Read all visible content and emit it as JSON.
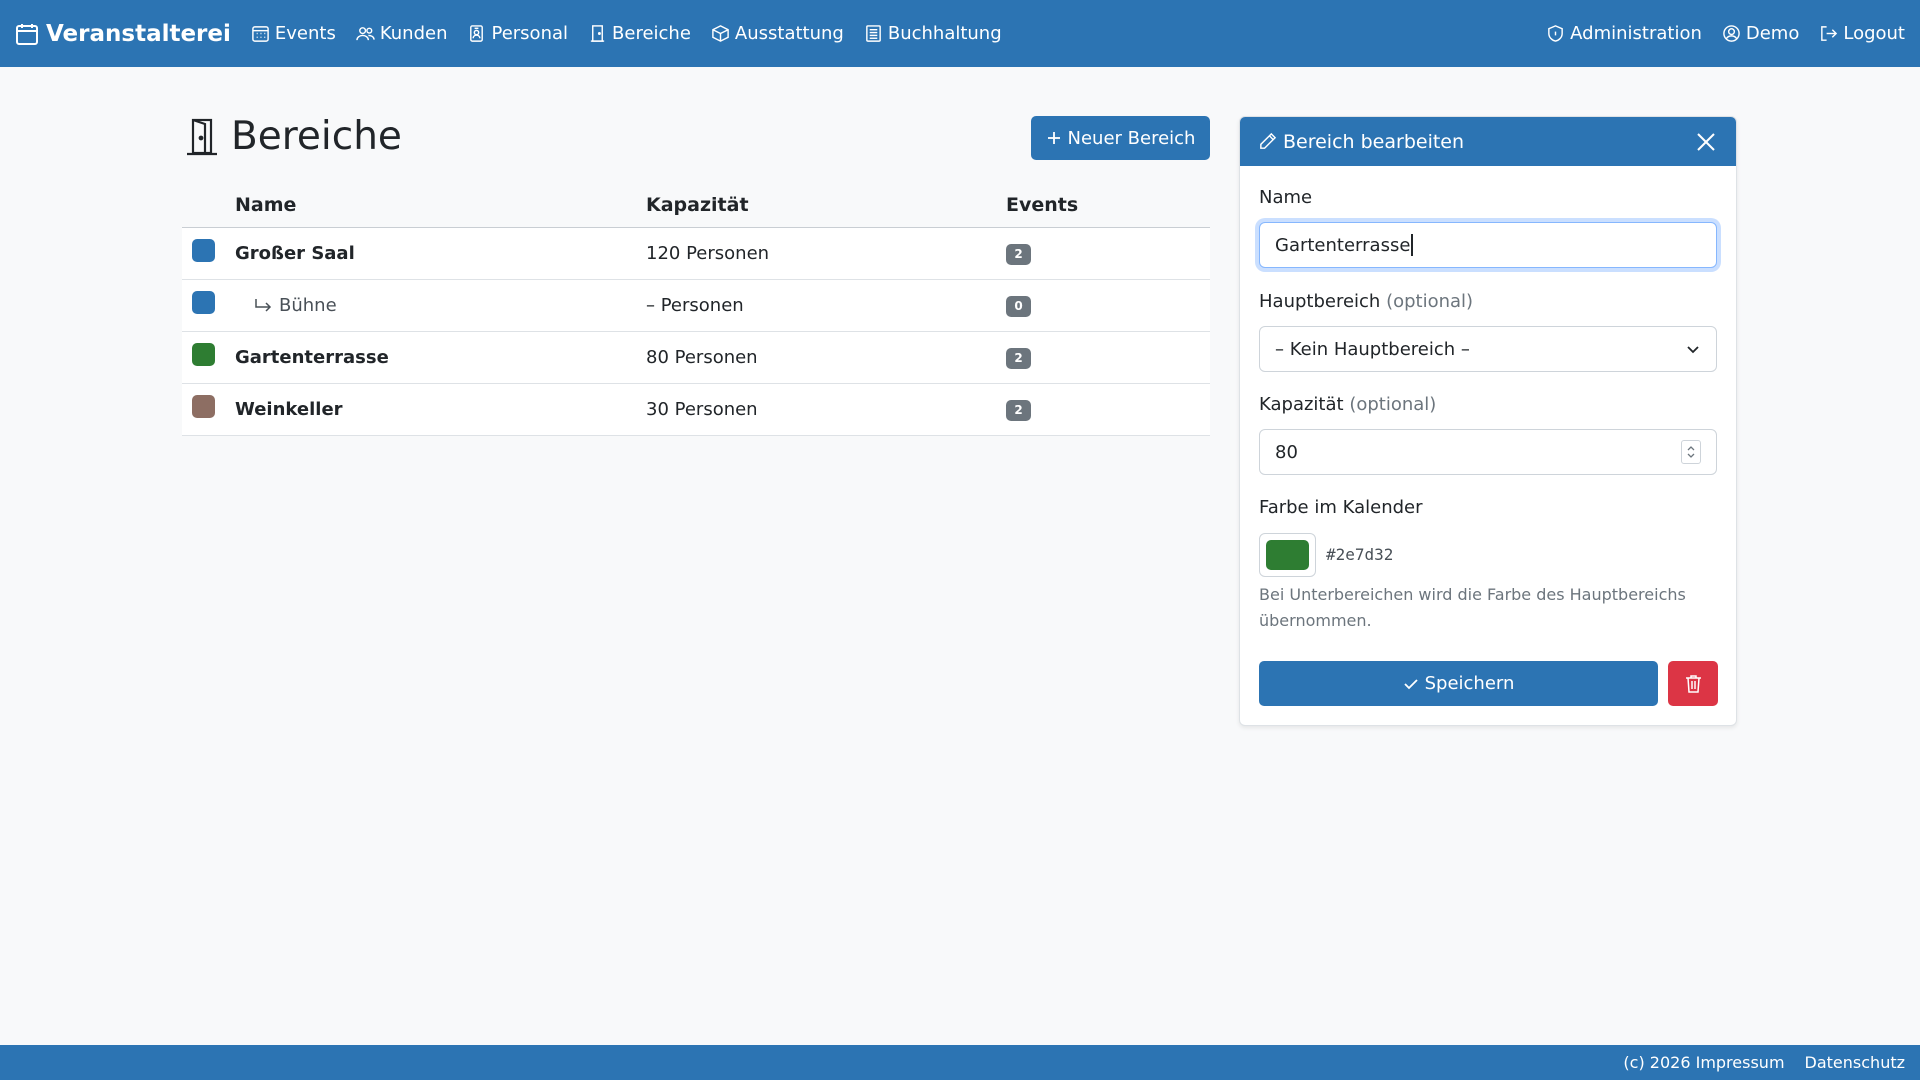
{
  "navbar": {
    "brand": "Veranstalterei",
    "links": [
      {
        "label": "Events",
        "icon": "calendar-grid-icon"
      },
      {
        "label": "Kunden",
        "icon": "people-icon"
      },
      {
        "label": "Personal",
        "icon": "badge-icon"
      },
      {
        "label": "Bereiche",
        "icon": "door-icon"
      },
      {
        "label": "Ausstattung",
        "icon": "box-icon"
      },
      {
        "label": "Buchhaltung",
        "icon": "ledger-icon"
      }
    ],
    "right": [
      {
        "label": "Administration",
        "icon": "shield-icon"
      },
      {
        "label": "Demo",
        "icon": "user-circle-icon"
      },
      {
        "label": "Logout",
        "icon": "logout-icon"
      }
    ]
  },
  "page": {
    "title": "Bereiche",
    "new_button": "Neuer Bereich"
  },
  "table": {
    "headers": {
      "name": "Name",
      "capacity": "Kapazität",
      "events": "Events"
    },
    "rows": [
      {
        "name": "Großer Saal",
        "capacity": "120 Personen",
        "events": "2",
        "color": "#2c74b3",
        "sub": false
      },
      {
        "name": "Bühne",
        "capacity": "– Personen",
        "events": "0",
        "color": "#2c74b3",
        "sub": true
      },
      {
        "name": "Gartenterrasse",
        "capacity": "80 Personen",
        "events": "2",
        "color": "#2e7d32",
        "sub": false
      },
      {
        "name": "Weinkeller",
        "capacity": "30 Personen",
        "events": "2",
        "color": "#8d6e63",
        "sub": false
      }
    ]
  },
  "editor": {
    "title": "Bereich bearbeiten",
    "name_label": "Name",
    "name_value": "Gartenterrasse",
    "parent_label": "Hauptbereich",
    "parent_optional": "(optional)",
    "parent_value": "– Kein Hauptbereich –",
    "capacity_label": "Kapazität",
    "capacity_optional": "(optional)",
    "capacity_value": "80",
    "color_label": "Farbe im Kalender",
    "color_value": "#2e7d32",
    "color_hex_text": "#2e7d32",
    "help_text": "Bei Unterbereichen wird die Farbe des Hauptbereichs übernommen.",
    "save_label": "Speichern"
  },
  "footer": {
    "copyright": "(c) 2026 Impressum",
    "privacy": "Datenschutz"
  },
  "colors": {
    "primary": "#2c74b3",
    "danger": "#dc3545"
  }
}
